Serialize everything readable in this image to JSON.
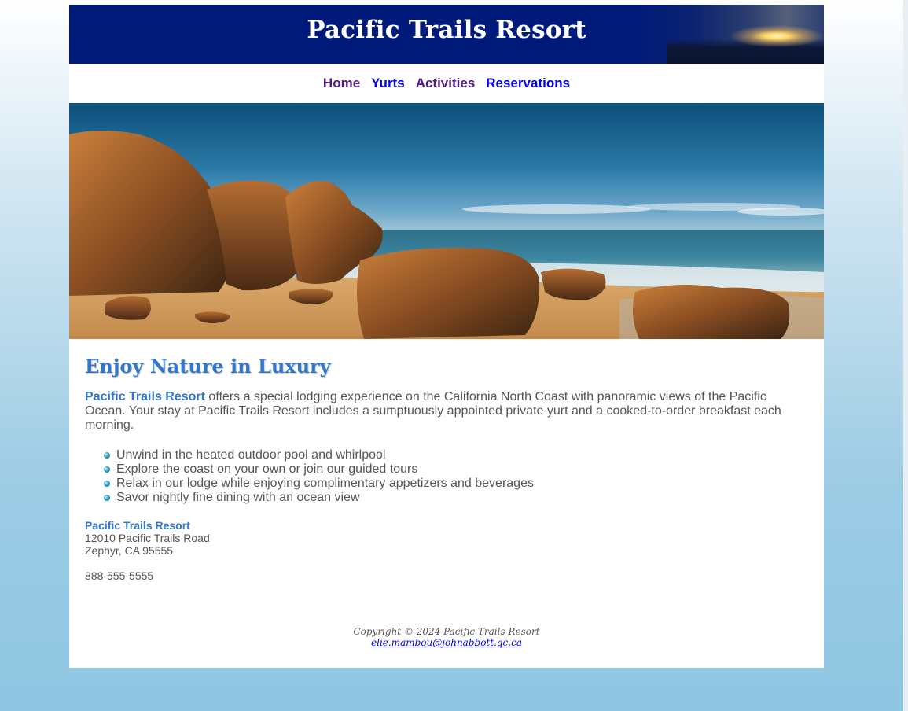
{
  "header": {
    "title": "Pacific Trails Resort"
  },
  "nav": {
    "items": [
      {
        "label": "Home",
        "state": "visited"
      },
      {
        "label": "Yurts",
        "state": "unvisited"
      },
      {
        "label": "Activities",
        "state": "visited"
      },
      {
        "label": "Reservations",
        "state": "unvisited"
      }
    ]
  },
  "hero": {
    "description_icon": "beach-rocks-image"
  },
  "main": {
    "heading": "Enjoy Nature in Luxury",
    "intro_name": "Pacific Trails Resort",
    "intro_text": " offers a special lodging experience on the California North Coast with panoramic views of the Pacific Ocean. Your stay at Pacific Trails Resort includes a sumptuously appointed private yurt and a cooked-to-order breakfast each morning.",
    "features": [
      "Unwind in the heated outdoor pool and whirlpool",
      "Explore the coast on your own or join our guided tours",
      "Relax in our lodge while enjoying complimentary appetizers and beverages",
      "Savor nightly fine dining with an ocean view"
    ],
    "contact": {
      "name": "Pacific Trails Resort",
      "street": "12010 Pacific Trails Road",
      "city": "Zephyr, CA 95555",
      "phone": "888-555-5555"
    }
  },
  "footer": {
    "copyright": "Copyright © 2024 Pacific Trails Resort",
    "email": "elie.mambou@johnabbott.qc.ca"
  },
  "colors": {
    "banner": "#001a7a",
    "accent": "#3377cc",
    "text": "#555555",
    "visited_link": "#551a8b",
    "link": "#0000ee"
  }
}
